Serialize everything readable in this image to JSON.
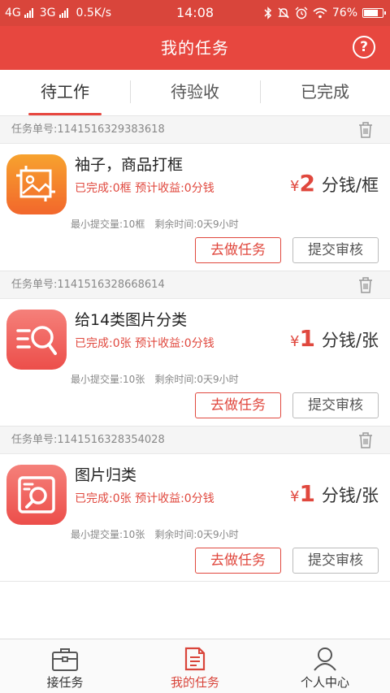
{
  "status_bar": {
    "network_left": "4G",
    "network_right": "3G",
    "speed": "0.5K/s",
    "time": "14:08",
    "battery": "76%",
    "battery_level": 0.76
  },
  "header": {
    "title": "我的任务",
    "help_symbol": "?"
  },
  "tabs": [
    {
      "label": "待工作",
      "active": true
    },
    {
      "label": "待验收",
      "active": false
    },
    {
      "label": "已完成",
      "active": false
    }
  ],
  "tasks": [
    {
      "id_label": "任务单号:1141516329383618",
      "name": "袖子，商品打框",
      "progress": "已完成:0框  预计收益:0分钱",
      "price_symbol": "¥",
      "price_value": "2",
      "price_unit": "分钱/框",
      "min_submit": "最小提交量:10框",
      "time_left": "剩余时间:0天9小时",
      "do_label": "去做任务",
      "submit_label": "提交审核",
      "icon": "frame-image-icon",
      "icon_color_top": "#f7a22e",
      "icon_color_bottom": "#f2672c"
    },
    {
      "id_label": "任务单号:1141516328668614",
      "name": "给14类图片分类",
      "progress": "已完成:0张  预计收益:0分钱",
      "price_symbol": "¥",
      "price_value": "1",
      "price_unit": "分钱/张",
      "min_submit": "最小提交量:10张",
      "time_left": "剩余时间:0天9小时",
      "do_label": "去做任务",
      "submit_label": "提交审核",
      "icon": "list-search-icon",
      "icon_color_top": "#f5807a",
      "icon_color_bottom": "#ec4e4a"
    },
    {
      "id_label": "任务单号:1141516328354028",
      "name": "图片归类",
      "progress": "已完成:0张  预计收益:0分钱",
      "price_symbol": "¥",
      "price_value": "1",
      "price_unit": "分钱/张",
      "min_submit": "最小提交量:10张",
      "time_left": "剩余时间:0天9小时",
      "do_label": "去做任务",
      "submit_label": "提交审核",
      "icon": "image-search-icon",
      "icon_color_top": "#f5807a",
      "icon_color_bottom": "#ec4e4a"
    }
  ],
  "bottom_nav": [
    {
      "label": "接任务",
      "icon": "briefcase-icon",
      "active": false
    },
    {
      "label": "我的任务",
      "icon": "document-icon",
      "active": true
    },
    {
      "label": "个人中心",
      "icon": "person-icon",
      "active": false
    }
  ],
  "colors": {
    "accent": "#e7473f",
    "status_bar": "#d9453b",
    "price": "#e0483e"
  }
}
